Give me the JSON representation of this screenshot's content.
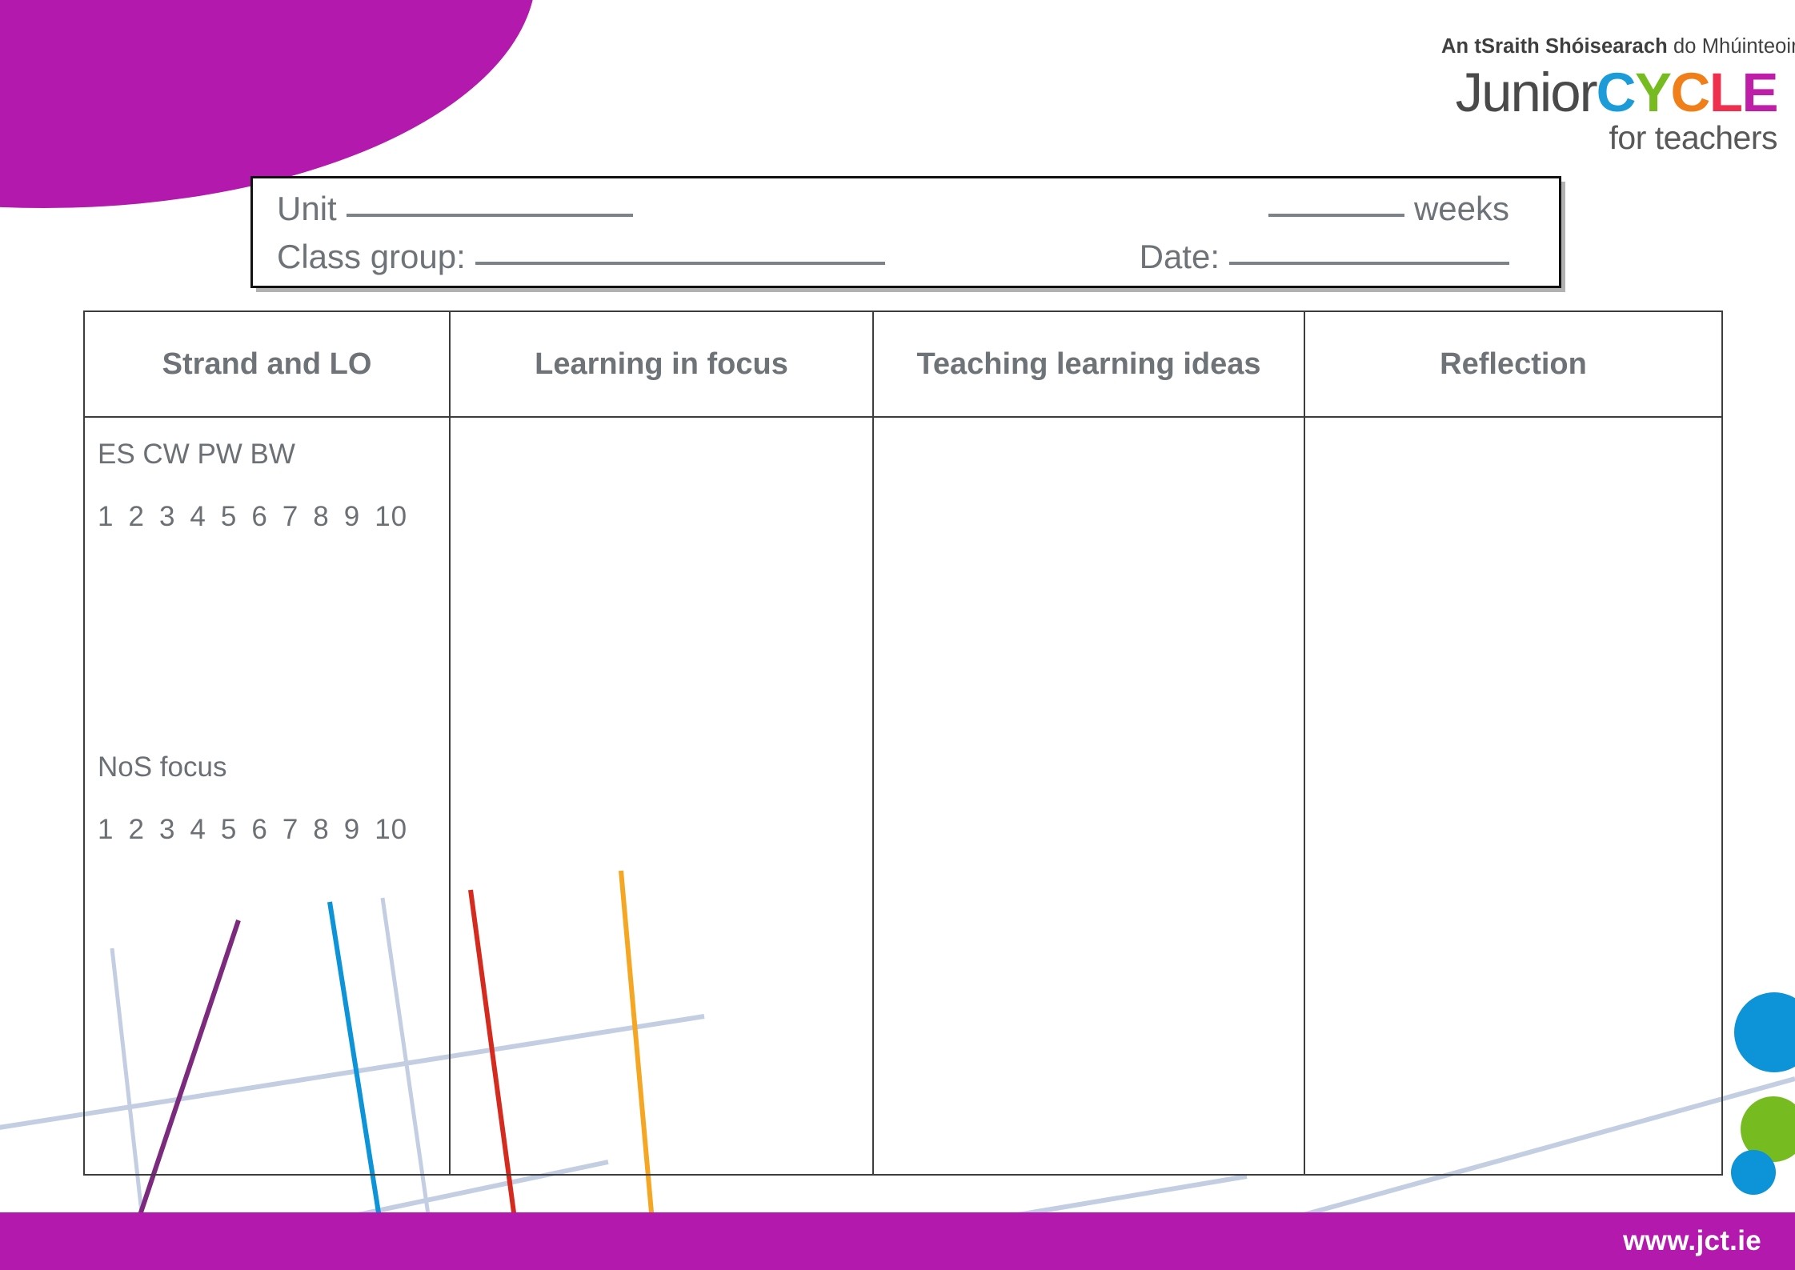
{
  "logo": {
    "tagline_bold": "An tSraith Shóisearach",
    "tagline_rest": " do Mhúinteoirí",
    "word_junior": "Junior",
    "word_c1": "C",
    "word_y": "Y",
    "word_c2": "C",
    "word_l": "L",
    "word_e": "E",
    "subtitle": "for teachers",
    "colors": {
      "junior": "#4a4a4a",
      "c1": "#1B9BD8",
      "y": "#76BC21",
      "c2": "#F07F1A",
      "l": "#EE2F4D",
      "e": "#BF1FA8"
    }
  },
  "info_box": {
    "unit_label": "Unit",
    "unit_blank": "",
    "weeks_label": "weeks",
    "weeks_blank": "",
    "class_group_label": "Class group:",
    "class_group_blank": "",
    "date_label": "Date:",
    "date_blank": ""
  },
  "table": {
    "headers": [
      "Strand and LO",
      "Learning in focus",
      "Teaching learning ideas",
      "Reflection"
    ],
    "strand_row": {
      "strand_codes": "ES CW PW BW",
      "strand_scale": [
        "1",
        "2",
        "3",
        "4",
        "5",
        "6",
        "7",
        "8",
        "9",
        "10"
      ],
      "nos_label": "NoS focus",
      "nos_scale": [
        "1",
        "2",
        "3",
        "4",
        "5",
        "6",
        "7",
        "8",
        "9",
        "10"
      ]
    },
    "learning_in_focus_content": "",
    "teaching_learning_ideas_content": "",
    "reflection_content": ""
  },
  "footer": {
    "url": "www.jct.ie"
  },
  "decor": {
    "blob_color": "#B419AE",
    "footer_color": "#B419AE",
    "dot_blue": "#0C93D8",
    "dot_green": "#76BC21",
    "line_purple": "#7B2A7E",
    "line_blue": "#0C93D8",
    "line_red": "#D52B1E",
    "line_orange": "#F5A623",
    "line_pale": "#C3CEE3"
  }
}
